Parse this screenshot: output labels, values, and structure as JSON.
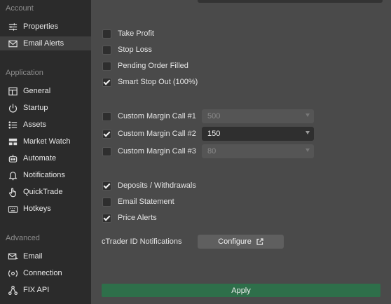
{
  "sidebar": {
    "sections": [
      {
        "title": "Account",
        "items": [
          {
            "label": "Properties",
            "icon": "sliders-icon"
          },
          {
            "label": "Email Alerts",
            "icon": "envelope-icon",
            "active": true
          }
        ]
      },
      {
        "title": "Application",
        "items": [
          {
            "label": "General",
            "icon": "layout-icon"
          },
          {
            "label": "Startup",
            "icon": "power-icon"
          },
          {
            "label": "Assets",
            "icon": "list-icon"
          },
          {
            "label": "Market Watch",
            "icon": "market-watch-icon"
          },
          {
            "label": "Automate",
            "icon": "robot-icon"
          },
          {
            "label": "Notifications",
            "icon": "bell-icon"
          },
          {
            "label": "QuickTrade",
            "icon": "hand-pointer-icon"
          },
          {
            "label": "Hotkeys",
            "icon": "keyboard-icon"
          }
        ]
      },
      {
        "title": "Advanced",
        "items": [
          {
            "label": "Email",
            "icon": "email-arrow-icon"
          },
          {
            "label": "Connection",
            "icon": "connection-icon"
          },
          {
            "label": "FIX API",
            "icon": "network-icon"
          }
        ]
      }
    ]
  },
  "alerts": [
    {
      "label": "Take Profit",
      "checked": false
    },
    {
      "label": "Stop Loss",
      "checked": false
    },
    {
      "label": "Pending Order Filled",
      "checked": false
    },
    {
      "label": "Smart Stop Out (100%)",
      "checked": true
    }
  ],
  "margin_calls": [
    {
      "label": "Custom Margin Call #1",
      "checked": false,
      "value": "500"
    },
    {
      "label": "Custom Margin Call #2",
      "checked": true,
      "value": "150"
    },
    {
      "label": "Custom Margin Call #3",
      "checked": false,
      "value": "80"
    }
  ],
  "other_alerts": [
    {
      "label": "Deposits / Withdrawals",
      "checked": true
    },
    {
      "label": "Email Statement",
      "checked": false
    },
    {
      "label": "Price Alerts",
      "checked": true
    }
  ],
  "ctrader": {
    "label": "cTrader ID Notifications",
    "button_label": "Configure",
    "button_icon": "external-link-icon"
  },
  "apply_label": "Apply",
  "colors": {
    "apply_bg": "#2e6f4a",
    "sidebar_bg": "#2b2b2b",
    "main_bg": "#4a4a4a"
  }
}
